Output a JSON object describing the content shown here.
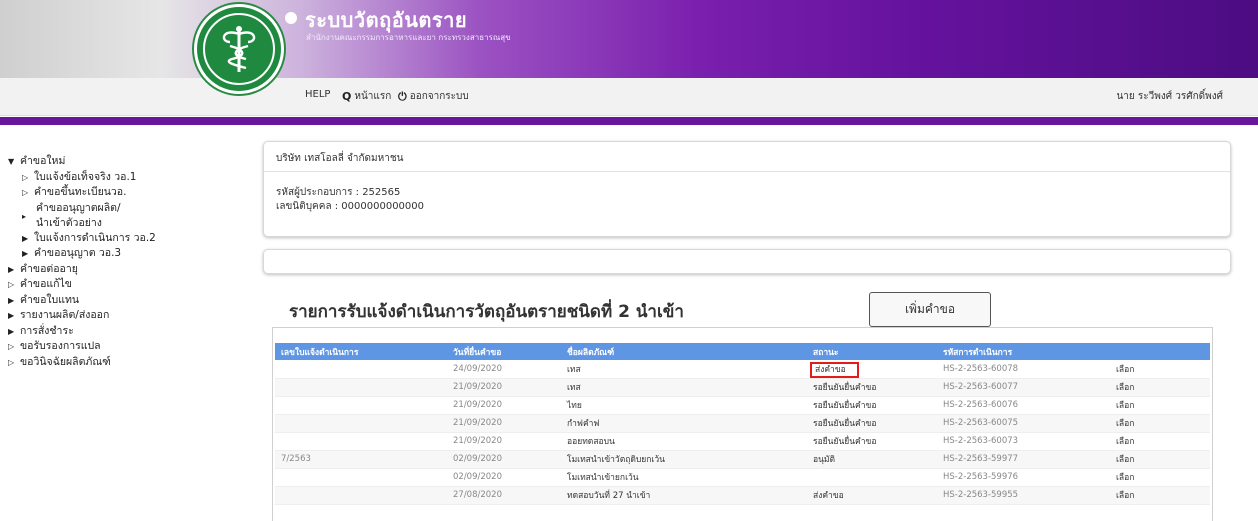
{
  "header": {
    "title": "ระบบวัตถุอันตราย",
    "subtitle": "สำนักงานคณะกรรมการอาหารและยา กระทรวงสาธารณสุข",
    "logo_text": "กระทรวงสาธารณสุข MINISTRY OF PUBLIC HEALTH"
  },
  "nav": {
    "help": "HELP",
    "home": "หน้าแรก",
    "logout": "ออกจากระบบ",
    "user": "นาย ระวีพงศ์ วรศักดิ์พงศ์"
  },
  "sidebar": {
    "items": [
      {
        "label": "คำขอใหม่",
        "marker": "▼",
        "level": 1
      },
      {
        "label": "ใบแจ้งข้อเท็จจริง วอ.1",
        "marker": "▷",
        "level": 2
      },
      {
        "label": "คำขอขึ้นทะเบียนวอ.",
        "marker": "▷",
        "level": 2
      },
      {
        "label": "คำขออนุญาตผลิต/นำเข้าตัวอย่าง",
        "marker": "▸",
        "level": 2
      },
      {
        "label": "ใบแจ้งการดำเนินการ วอ.2",
        "marker": "▶",
        "level": 2
      },
      {
        "label": "คำขออนุญาต วอ.3",
        "marker": "▶",
        "level": 2
      },
      {
        "label": "คำขอต่ออายุ",
        "marker": "▶",
        "level": 1
      },
      {
        "label": "คำขอแก้ไข",
        "marker": "▷",
        "level": 1
      },
      {
        "label": "คำขอใบแทน",
        "marker": "▶",
        "level": 1
      },
      {
        "label": "รายงานผลิต/ส่งออก",
        "marker": "▶",
        "level": 1
      },
      {
        "label": "การสั่งชำระ",
        "marker": "▶",
        "level": 1
      },
      {
        "label": "ขอรับรองการแปล",
        "marker": "▷",
        "level": 1
      },
      {
        "label": "ขอวินิจฉัยผลิตภัณฑ์",
        "marker": "▷",
        "level": 1
      }
    ]
  },
  "company": {
    "name": "บริษัท เทสโอลลี่ จำกัดมหาชน",
    "operator_id": "รหัสผู้ประกอบการ : 252565",
    "juristic_id": "เลขนิติบุคคล : 0000000000000"
  },
  "list": {
    "title": "รายการรับแจ้งดำเนินการวัตถุอันตรายชนิดที่ 2 นำเข้า",
    "add_button": "เพิ่มคำขอ",
    "columns": [
      "เลขใบแจ้งดำเนินการ",
      "วันที่ยื่นคำขอ",
      "ชื่อผลิตภัณฑ์",
      "สถานะ",
      "รหัสการดำเนินการ",
      ""
    ],
    "rows": [
      {
        "no": "",
        "date": "24/09/2020",
        "product": "เทส",
        "status": "ส่งคำขอ",
        "code": "HS-2-2563-60078",
        "action": "เลือก"
      },
      {
        "no": "",
        "date": "21/09/2020",
        "product": "เทส",
        "status": "รอยืนยันยื่นคำขอ",
        "code": "HS-2-2563-60077",
        "action": "เลือก"
      },
      {
        "no": "",
        "date": "21/09/2020",
        "product": "ไทย",
        "status": "รอยืนยันยื่นคำขอ",
        "code": "HS-2-2563-60076",
        "action": "เลือก"
      },
      {
        "no": "",
        "date": "21/09/2020",
        "product": "กำฟคำฟ",
        "status": "รอยืนยันยื่นคำขอ",
        "code": "HS-2-2563-60075",
        "action": "เลือก"
      },
      {
        "no": "",
        "date": "21/09/2020",
        "product": "ออยทดสอบน",
        "status": "รอยืนยันยื่นคำขอ",
        "code": "HS-2-2563-60073",
        "action": "เลือก"
      },
      {
        "no": "7/2563",
        "date": "02/09/2020",
        "product": "โมเทสนำเข้าวัตถุดิบยกเว้น",
        "status": "อนุมัติ",
        "code": "HS-2-2563-59977",
        "action": "เลือก"
      },
      {
        "no": "",
        "date": "02/09/2020",
        "product": "โมเทสนำเข้ายกเว้น",
        "status": "",
        "code": "HS-2-2563-59976",
        "action": "เลือก"
      },
      {
        "no": "",
        "date": "27/08/2020",
        "product": "ทดสอบวันที่ 27 นำเข้า",
        "status": "ส่งคำขอ",
        "code": "HS-2-2563-59955",
        "action": "เลือก"
      }
    ]
  },
  "colors": {
    "banner_purple": "#68179c",
    "table_header": "#5f96e3",
    "highlight_red": "#e31b1b",
    "logo_green": "#1f8a3f"
  },
  "icons": {
    "home": "search-icon",
    "logout": "power-icon"
  }
}
